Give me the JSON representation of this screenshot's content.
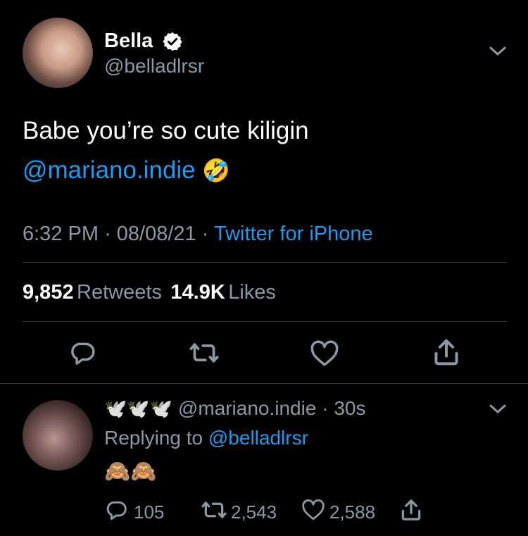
{
  "tweet": {
    "author": {
      "name": "Bella",
      "handle": "@belladlrsr",
      "verified": true
    },
    "text_line1": "Babe you’re so cute kiligin",
    "mention": "@mariano.indie",
    "emoji": "🤣",
    "time": "6:32 PM",
    "date": "08/08/21",
    "source": "Twitter for iPhone",
    "retweets_count": "9,852",
    "retweets_label": "Retweets",
    "likes_count": "14.9K",
    "likes_label": "Likes"
  },
  "reply": {
    "name_emoji": "🕊️🕊️🕊️",
    "handle": "@mariano.indie",
    "dot": "·",
    "time": "30s",
    "replying_label": "Replying to",
    "replying_handle": "@belladlrsr",
    "text": "🙈🙈",
    "reply_count": "105",
    "retweet_count": "2,543",
    "like_count": "2,588"
  },
  "separators": {
    "dot": "·"
  },
  "colors": {
    "accent": "#1d9bf0",
    "secondary_text": "#8b98a5",
    "divider": "#2f3336",
    "background": "#000000"
  }
}
